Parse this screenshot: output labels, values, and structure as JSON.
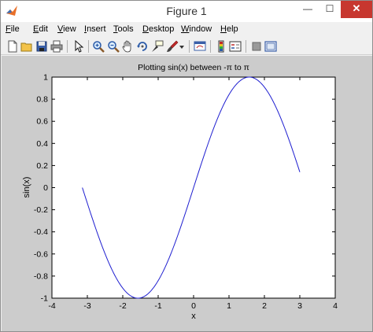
{
  "window": {
    "title": "Figure 1",
    "min_glyph": "—",
    "max_glyph": "☐",
    "close_glyph": "✕"
  },
  "menu": [
    {
      "key": "file",
      "u": "F",
      "rest": "ile"
    },
    {
      "key": "edit",
      "u": "E",
      "rest": "dit"
    },
    {
      "key": "view",
      "u": "V",
      "rest": "iew"
    },
    {
      "key": "insert",
      "u": "I",
      "rest": "nsert"
    },
    {
      "key": "tools",
      "u": "T",
      "rest": "ools"
    },
    {
      "key": "desktop",
      "u": "D",
      "rest": "esktop"
    },
    {
      "key": "window",
      "u": "W",
      "rest": "indow"
    },
    {
      "key": "help",
      "u": "H",
      "rest": "elp"
    }
  ],
  "toolbar_icons": [
    "new-figure-icon",
    "open-file-icon",
    "save-figure-icon",
    "print-figure-icon",
    "edit-plot-arrow-icon",
    "zoom-in-icon",
    "zoom-out-icon",
    "pan-hand-icon",
    "rotate-3d-icon",
    "data-cursor-icon",
    "brush-icon",
    "brush-dropdown-icon",
    "link-plot-icon",
    "insert-colorbar-icon",
    "insert-legend-icon",
    "hide-plot-tools-icon",
    "show-plot-tools-icon"
  ],
  "colors": {
    "line": "#1f1fd0",
    "figure_bg": "#cccccc",
    "axes_bg": "#ffffff"
  },
  "chart_data": {
    "type": "line",
    "title": "Plotting sin(x) between -π to π",
    "xlabel": "x",
    "ylabel": "sin(x)",
    "xlim": [
      -4,
      4
    ],
    "ylim": [
      -1,
      1
    ],
    "xticks": [
      -4,
      -3,
      -2,
      -1,
      0,
      1,
      2,
      3,
      4
    ],
    "yticks": [
      -1,
      -0.8,
      -0.6,
      -0.4,
      -0.2,
      0,
      0.2,
      0.4,
      0.6,
      0.8,
      1
    ],
    "grid": false,
    "series": [
      {
        "function": "sin(x)",
        "x_range": [
          -3.1416,
          3.0
        ],
        "x": [
          -3.1416,
          -2.8,
          -2.4,
          -2.0,
          -1.5708,
          -1.2,
          -0.8,
          -0.4,
          0,
          0.4,
          0.8,
          1.2,
          1.5708,
          2.0,
          2.4,
          2.8,
          3.0
        ],
        "y": [
          0,
          -0.335,
          -0.675,
          -0.909,
          -1,
          -0.932,
          -0.717,
          -0.389,
          0,
          0.389,
          0.717,
          0.932,
          1,
          0.909,
          0.675,
          0.335,
          0.141
        ]
      }
    ]
  }
}
